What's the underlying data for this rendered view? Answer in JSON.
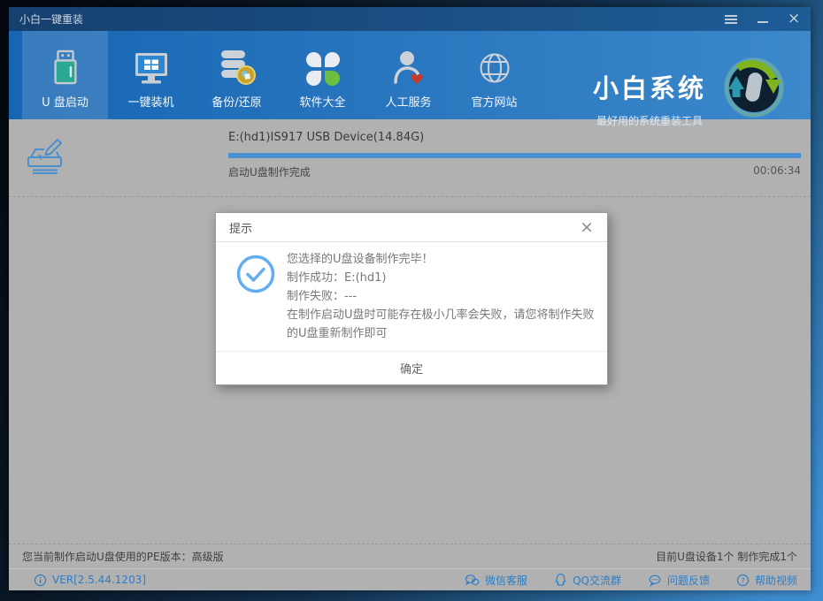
{
  "window": {
    "title": "小白一键重装",
    "controls": [
      {
        "icon": "menu-icon"
      },
      {
        "icon": "minimize-icon"
      },
      {
        "icon": "close-icon"
      }
    ]
  },
  "nav": {
    "items": [
      {
        "label": "U 盘启动",
        "icon": "usb-drive-icon",
        "selected": true
      },
      {
        "label": "一键装机",
        "icon": "monitor-windows-icon",
        "selected": false
      },
      {
        "label": "备份/还原",
        "icon": "backup-disks-coin-icon",
        "selected": false
      },
      {
        "label": "软件大全",
        "icon": "clover-icon",
        "selected": false
      },
      {
        "label": "人工服务",
        "icon": "person-heart-icon",
        "selected": false
      },
      {
        "label": "官方网站",
        "icon": "globe-icon",
        "selected": false
      }
    ],
    "brand": {
      "name": "小白系统",
      "tagline": "最好用的系统重装工具",
      "logo_icon": "refresh-arrows-logo"
    }
  },
  "progress": {
    "device": "E:(hd1)IS917 USB Device(14.84G)",
    "status": "启动U盘制作完成",
    "elapsed": "00:06:34",
    "percent": 100,
    "bar_color": "#4a8fd0",
    "icon": "drive-write-icon"
  },
  "dialog": {
    "title": "提示",
    "close_glyph": "×",
    "icon": "check-circle-icon",
    "lines": [
      "您选择的U盘设备制作完毕！",
      "制作成功：E:(hd1)",
      "制作失败：---",
      "在制作启动U盘时可能存在极小几率会失败，请您将制作失败的U盘重新制作即可"
    ],
    "ok_label": "确定"
  },
  "status_bar": {
    "left": "您当前制作启动U盘使用的PE版本：高级版",
    "right": "目前U盘设备1个 制作完成1个"
  },
  "bottom_bar": {
    "version": "VER[2.5.44.1203]",
    "version_icon": "info-icon",
    "links": [
      {
        "label": "微信客服",
        "icon": "wechat-icon"
      },
      {
        "label": "QQ交流群",
        "icon": "qq-icon"
      },
      {
        "label": "问题反馈",
        "icon": "feedback-bubble-icon"
      },
      {
        "label": "帮助视频",
        "icon": "help-icon"
      }
    ]
  },
  "colors": {
    "titlebar": "#17406f",
    "navbar": "#1f6fbb",
    "nav_selected_overlay": "rgba(255,255,255,0.14)",
    "content_bg": "#b1b1b1",
    "progress_bar": "#4a8fd0",
    "link_accent": "#2d7dc5",
    "check_blue": "#62aef0",
    "leaf_green": "#6cbf3f",
    "heart_red": "#c43a2c",
    "coin_gold": "#c9a22b"
  }
}
